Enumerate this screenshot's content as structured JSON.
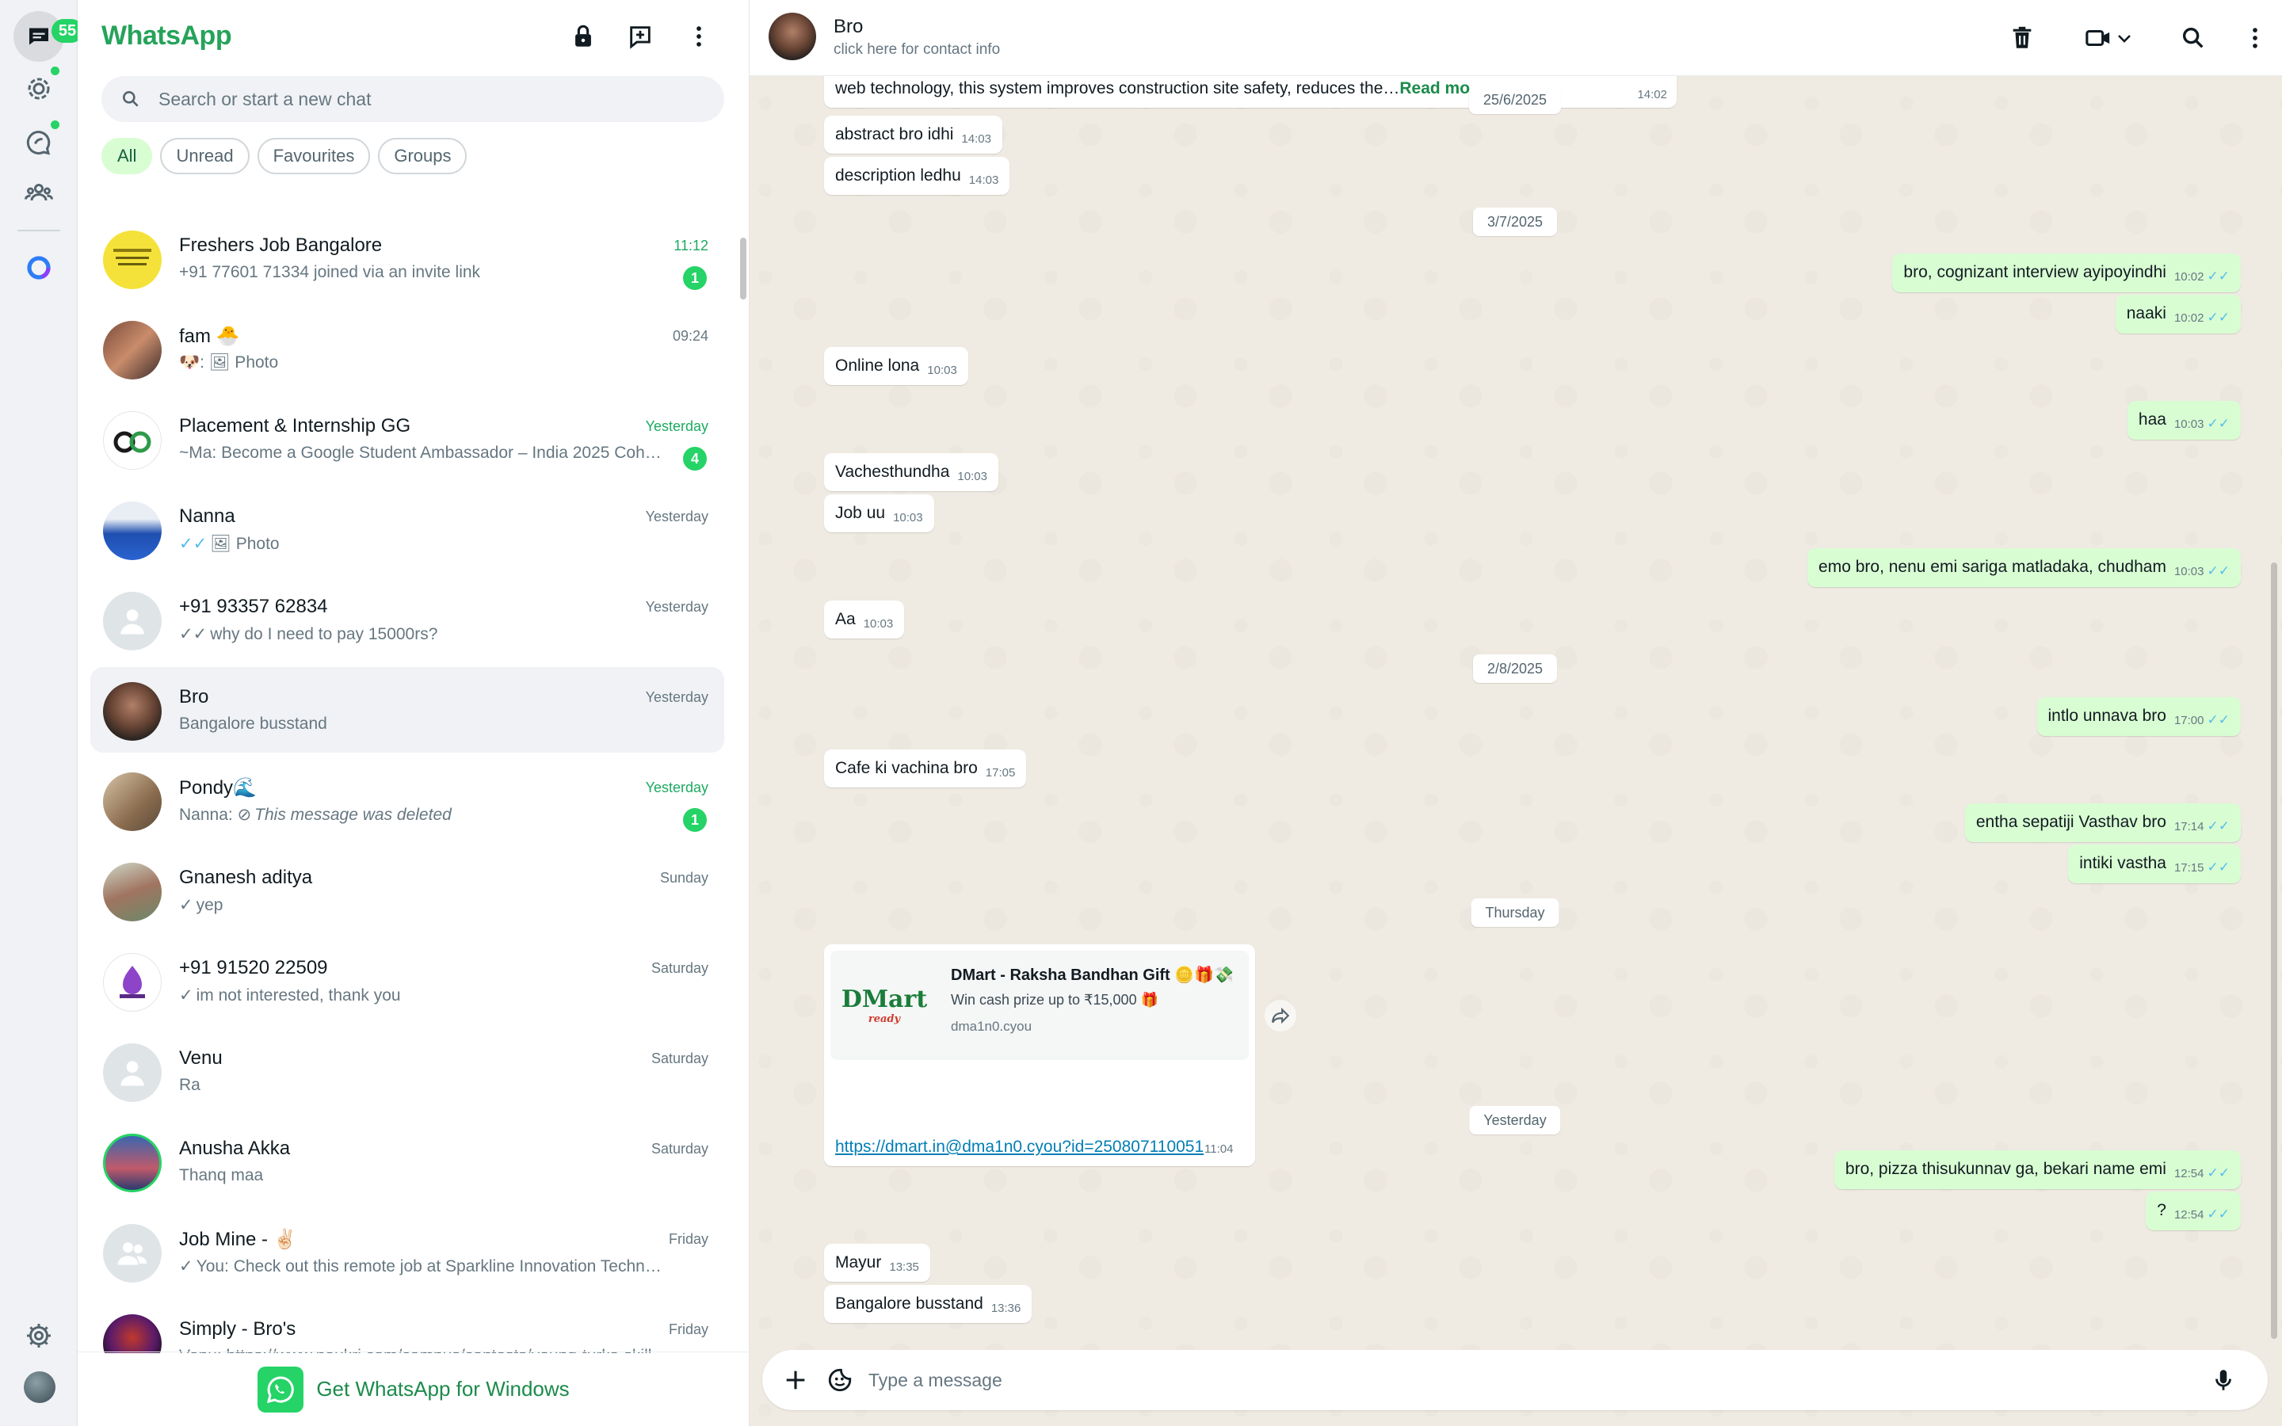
{
  "rail": {
    "chats_badge": "55"
  },
  "list": {
    "title": "WhatsApp",
    "search_placeholder": "Search or start a new chat",
    "filters": [
      "All",
      "Unread",
      "Favourites",
      "Groups"
    ],
    "chats": [
      {
        "name": "Freshers Job Bangalore",
        "time": "11:12",
        "preview": "+91 77601 71334 joined via an invite link",
        "unread": "1"
      },
      {
        "name": "fam 🐣",
        "time": "09:24",
        "preview": "🐶: 🖼 Photo"
      },
      {
        "name": "Placement & Internship GG",
        "time": "Yesterday",
        "preview": "~Ma: Become a Google Student Ambassador – India 2025 Cohort…",
        "unread": "4"
      },
      {
        "name": "Nanna",
        "time": "Yesterday",
        "preview": "🖼 Photo"
      },
      {
        "name": "+91 93357 62834",
        "time": "Yesterday",
        "preview": "why do I need to pay 15000rs?"
      },
      {
        "name": "Bro",
        "time": "Yesterday",
        "preview": "Bangalore busstand"
      },
      {
        "name": "Pondy🌊",
        "time": "Yesterday",
        "preview_prefix": "Nanna: ",
        "preview": "This message was deleted",
        "unread": "1"
      },
      {
        "name": "Gnanesh aditya",
        "time": "Sunday",
        "preview": "yep"
      },
      {
        "name": "+91 91520 22509",
        "time": "Saturday",
        "preview": "im not interested, thank you"
      },
      {
        "name": "Venu",
        "time": "Saturday",
        "preview": "Ra"
      },
      {
        "name": "Anusha Akka",
        "time": "Saturday",
        "preview": "Thanq maa"
      },
      {
        "name": "Job Mine - ✌🏻",
        "time": "Friday",
        "preview": "You: Check out this remote job at Sparkline Innovation Technologi…"
      },
      {
        "name": "Simply - Bro's",
        "time": "Friday",
        "preview": "Venu: https://www.naukri.com/campus/contests/young-turks-skills-a…"
      }
    ],
    "get_windows": "Get WhatsApp for Windows"
  },
  "conversation": {
    "name": "Bro",
    "subtitle": "click here for contact info",
    "composer_placeholder": "Type a message",
    "top_partial": {
      "text_fragment": "web technology, this system improves construction site safety, reduces the…",
      "read_more": "Read mo",
      "time": "14:02"
    },
    "dates": [
      "25/6/2025",
      "3/7/2025",
      "2/8/2025",
      "Thursday",
      "Yesterday"
    ],
    "messages": [
      {
        "text": "abstract bro idhi",
        "time": "14:03",
        "dir": "in"
      },
      {
        "text": "description ledhu",
        "time": "14:03",
        "dir": "in"
      },
      {
        "text": "bro, cognizant interview ayipoyindhi",
        "time": "10:02",
        "dir": "out"
      },
      {
        "text": "naaki",
        "time": "10:02",
        "dir": "out"
      },
      {
        "text": "Online lona",
        "time": "10:03",
        "dir": "in"
      },
      {
        "text": "haa",
        "time": "10:03",
        "dir": "out"
      },
      {
        "text": "Vachesthundha",
        "time": "10:03",
        "dir": "in"
      },
      {
        "text": "Job uu",
        "time": "10:03",
        "dir": "in"
      },
      {
        "text": "emo bro, nenu emi sariga matladaka, chudham",
        "time": "10:03",
        "dir": "out"
      },
      {
        "text": "Aa",
        "time": "10:03",
        "dir": "in"
      },
      {
        "text": "intlo unnava bro",
        "time": "17:00",
        "dir": "out"
      },
      {
        "text": "Cafe ki vachina bro",
        "time": "17:05",
        "dir": "in"
      },
      {
        "text": "entha sepatiji Vasthav bro",
        "time": "17:14",
        "dir": "out"
      },
      {
        "text": "intiki vastha",
        "time": "17:15",
        "dir": "out"
      },
      {
        "text": "bro, pizza thisukunnav ga, bekari name emi",
        "time": "12:54",
        "dir": "out"
      },
      {
        "text": "?",
        "time": "12:54",
        "dir": "out"
      },
      {
        "text": "Mayur",
        "time": "13:35",
        "dir": "in"
      },
      {
        "text": "Bangalore busstand",
        "time": "13:36",
        "dir": "in"
      }
    ],
    "link_card": {
      "logo": "DMart",
      "logo_sub": "ready",
      "title": "DMart - Raksha Bandhan Gift 🪙🎁💸",
      "description": "Win cash prize up to ₹15,000 🎁",
      "domain": "dma1n0.cyou",
      "url": "https://dmart.in@dma1n0.cyou?id=250807110051",
      "time": "11:04"
    },
    "read_tick": "✓✓"
  },
  "colors": {
    "brand": "#25a35a",
    "badge": "#25d366",
    "outgoing_bubble": "#d9fdd3",
    "chat_background": "#efeae2",
    "read_tick": "#53bdeb"
  }
}
